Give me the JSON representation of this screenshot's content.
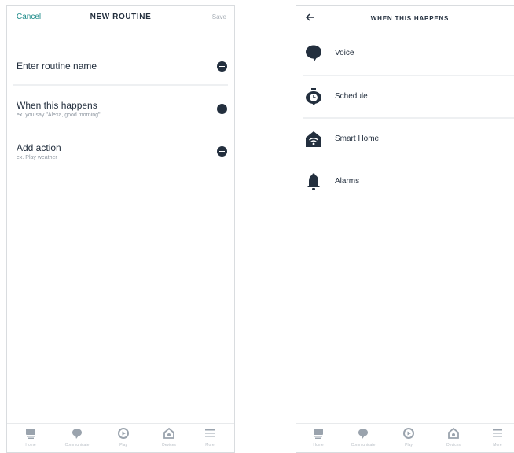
{
  "new_routine": {
    "cancel_label": "Cancel",
    "title": "NEW ROUTINE",
    "save_label": "Save",
    "rows": [
      {
        "label": "Enter routine name",
        "sublabel": ""
      },
      {
        "label": "When this happens",
        "sublabel": "ex. you say \"Alexa, good morning\""
      },
      {
        "label": "Add action",
        "sublabel": "ex. Play weather"
      }
    ],
    "accent_color": "#1f8c8a"
  },
  "when_this_happens": {
    "title": "WHEN THIS HAPPENS",
    "triggers": [
      {
        "label": "Voice",
        "icon": "voice-icon"
      },
      {
        "label": "Schedule",
        "icon": "schedule-icon"
      },
      {
        "label": "Smart Home",
        "icon": "smart-home-icon"
      },
      {
        "label": "Alarms",
        "icon": "alarm-bell-icon"
      }
    ]
  },
  "bottom_nav": {
    "items": [
      {
        "label": "Home",
        "icon": "home-list-icon"
      },
      {
        "label": "Communicate",
        "icon": "chat-bubble-icon"
      },
      {
        "label": "Play",
        "icon": "play-icon"
      },
      {
        "label": "Devices",
        "icon": "devices-house-icon"
      },
      {
        "label": "More",
        "icon": "menu-icon"
      }
    ]
  }
}
